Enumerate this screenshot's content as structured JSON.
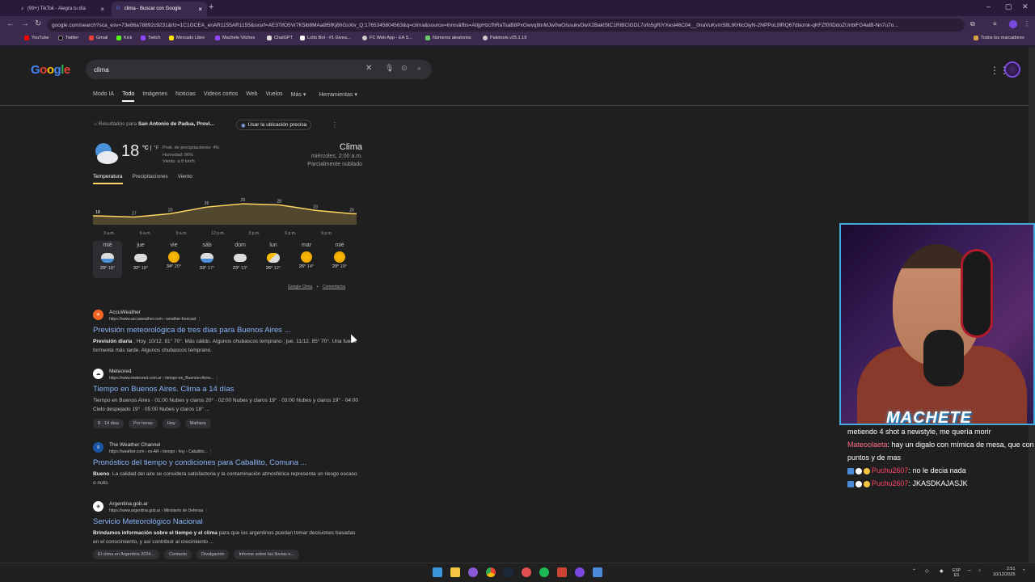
{
  "browser": {
    "tabs": [
      {
        "label": "(99+) TikTok - Alegra tu día"
      },
      {
        "label": "clima - Buscar con Google"
      }
    ],
    "url": "google.com/search?sca_esv=73e86a78892c9231&rlz=1C1GCEA_enAR1155AR1155&sxsrf=AE3TifO5Vr7K5ib8MAaI85fKj6hGsXiv_Q:1765345804563&q=clima&source=lnms&fbs=AIIjpHzcfhRaTsaB8PxGwvqIttnMJw0wOIssukvDwX2BaklStC1RiBClGDL7ofo5gRiYXesl46C04__0naVuKvmS8LtKHlcOiyN-2NPPoL9lRQ67dteznk-qKFZf00DdoZUnblFG4alB-Nn7u7o...",
    "bookmarks": [
      "YouTube",
      "Twitter",
      "Gmail",
      "Kick",
      "Twitch",
      "Mercado Libre",
      "Machete Vilches",
      "ChatGPT",
      "Lotto Bot - #1 Givea...",
      "FC Web App - EA S...",
      "Números aleatorios",
      "Paletools v25.1.19"
    ],
    "all_bookmarks": "Todos los marcadores"
  },
  "google": {
    "logo": "Google",
    "query": "clima",
    "filters": [
      "Modo IA",
      "Todo",
      "Imágenes",
      "Noticias",
      "Videos cortos",
      "Web",
      "Vuelos",
      "Más",
      "Herramientas"
    ],
    "location_text": "Resultados para ",
    "location_place": "San Antonio de Padua, Provi...",
    "location_button": "Usar la ubicación precisa"
  },
  "weather": {
    "temp": "18",
    "unit_c": "°C",
    "unit_f": "°F",
    "precip": "Prob. de precipitaciones: 4%",
    "humidity": "Humedad: 96%",
    "wind": "Viento: a 8 km/h",
    "title": "Clima",
    "datetime": "miércoles, 2:00 a.m.",
    "condition": "Parcialmente nublado",
    "tabs": [
      "Temperatura",
      "Precipitaciones",
      "Viento"
    ],
    "footer_links": [
      "Google Clima",
      "Comentarios"
    ],
    "accent": "#fdd663"
  },
  "chart_data": {
    "type": "area",
    "x": [
      "3 a.m.",
      "6 a.m.",
      "9 a.m.",
      "12 p.m.",
      "3 p.m.",
      "6 p.m.",
      "9 p.m.",
      "12 a.m."
    ],
    "point_labels": [
      "18",
      "17",
      "20",
      "26",
      "29",
      "28",
      "23",
      "20"
    ],
    "values": [
      18,
      17,
      20,
      26,
      29,
      28,
      23,
      20
    ]
  },
  "days": [
    {
      "name": "mié",
      "icon": "storm-icon",
      "hi": "29°",
      "lo": "18°"
    },
    {
      "name": "jue",
      "icon": "cloud-icon",
      "hi": "32°",
      "lo": "18°"
    },
    {
      "name": "vie",
      "icon": "sun-icon",
      "hi": "34°",
      "lo": "20°"
    },
    {
      "name": "sáb",
      "icon": "rain-icon",
      "hi": "33°",
      "lo": "17°"
    },
    {
      "name": "dom",
      "icon": "cloud-icon",
      "hi": "23°",
      "lo": "13°"
    },
    {
      "name": "lun",
      "icon": "partly-cloudy-icon",
      "hi": "26°",
      "lo": "12°"
    },
    {
      "name": "mar",
      "icon": "sun-icon",
      "hi": "26°",
      "lo": "14°"
    },
    {
      "name": "mié",
      "icon": "sun-icon",
      "hi": "29°",
      "lo": "19°"
    }
  ],
  "results": [
    {
      "site": "AccuWeather",
      "url": "https://www.accuweather.com › weather-forecast",
      "title": "Previsión meteorológica de tres días para Buenos Aires ...",
      "snippet_bold": "Previsión diaria",
      "snippet": " ; Hoy. 10/12. 81° 70°. Más cálido. Algunos chubascos temprano ; jue. 11/12. 85° 70°. Una fuerte tormenta más tarde. Algunos chubascos temprano.",
      "chips": []
    },
    {
      "site": "Meteored",
      "url": "https://www.meteored.com.ar › tiempo-en_Buenos+Aires...",
      "title": "Tiempo en Buenos Aires. Clima a 14 días",
      "snippet_bold": "",
      "snippet": "Tiempo en Buenos Aires · 01:00 Nubes y claros 20° · 02:00 Nubes y claros 19° · 03:00 Nubes y claros 19° · 04:00 Cielo despejado 19° · 05:00 Nubes y claros 18° ...",
      "chips": [
        "8 - 14 días",
        "Por horas",
        "Hoy",
        "Mañana"
      ]
    },
    {
      "site": "The Weather Channel",
      "url": "https://weather.com › es-AR › tiempo › hoy › Caballito...",
      "title": "Pronóstico del tiempo y condiciones para Caballito, Comuna ...",
      "snippet_bold": "Bueno",
      "snippet": ". La calidad del aire se considera satisfactoria y la contaminación atmosférica representa un riesgo escaso o nulo.",
      "chips": []
    },
    {
      "site": "Argentina.gob.ar",
      "url": "https://www.argentina.gob.ar › Ministerio de Defensa",
      "title": "Servicio Meteorológico Nacional",
      "snippet_bold": "Brindamos información sobre el tiempo y el clima",
      "snippet": " para que los argentinos puedan tomar decisiones basadas en el conocimiento, y así contribuir al crecimiento ...",
      "chips": [
        "El clima en Argentina 2024...",
        "Contacto",
        "Divulgación",
        "Informe sobre las lluvias e..."
      ]
    }
  ],
  "stream": {
    "name": "MACHETE",
    "chat": [
      {
        "user": "",
        "msg": "metiendo 4 shot a newstyle, me quería morir"
      },
      {
        "user": "Mateoolaeta",
        "msg": ": hay un digalo con mímica de mesa, que con puntos y de mas"
      },
      {
        "user": "Puchu2607",
        "msg": ": no le decia nada"
      },
      {
        "user": "Puchu2607",
        "msg": ": JKASDKAJASJK"
      }
    ]
  },
  "taskbar": {
    "lang1": "ESP",
    "lang2": "ES",
    "time": "2:51",
    "date": "10/12/2025"
  }
}
